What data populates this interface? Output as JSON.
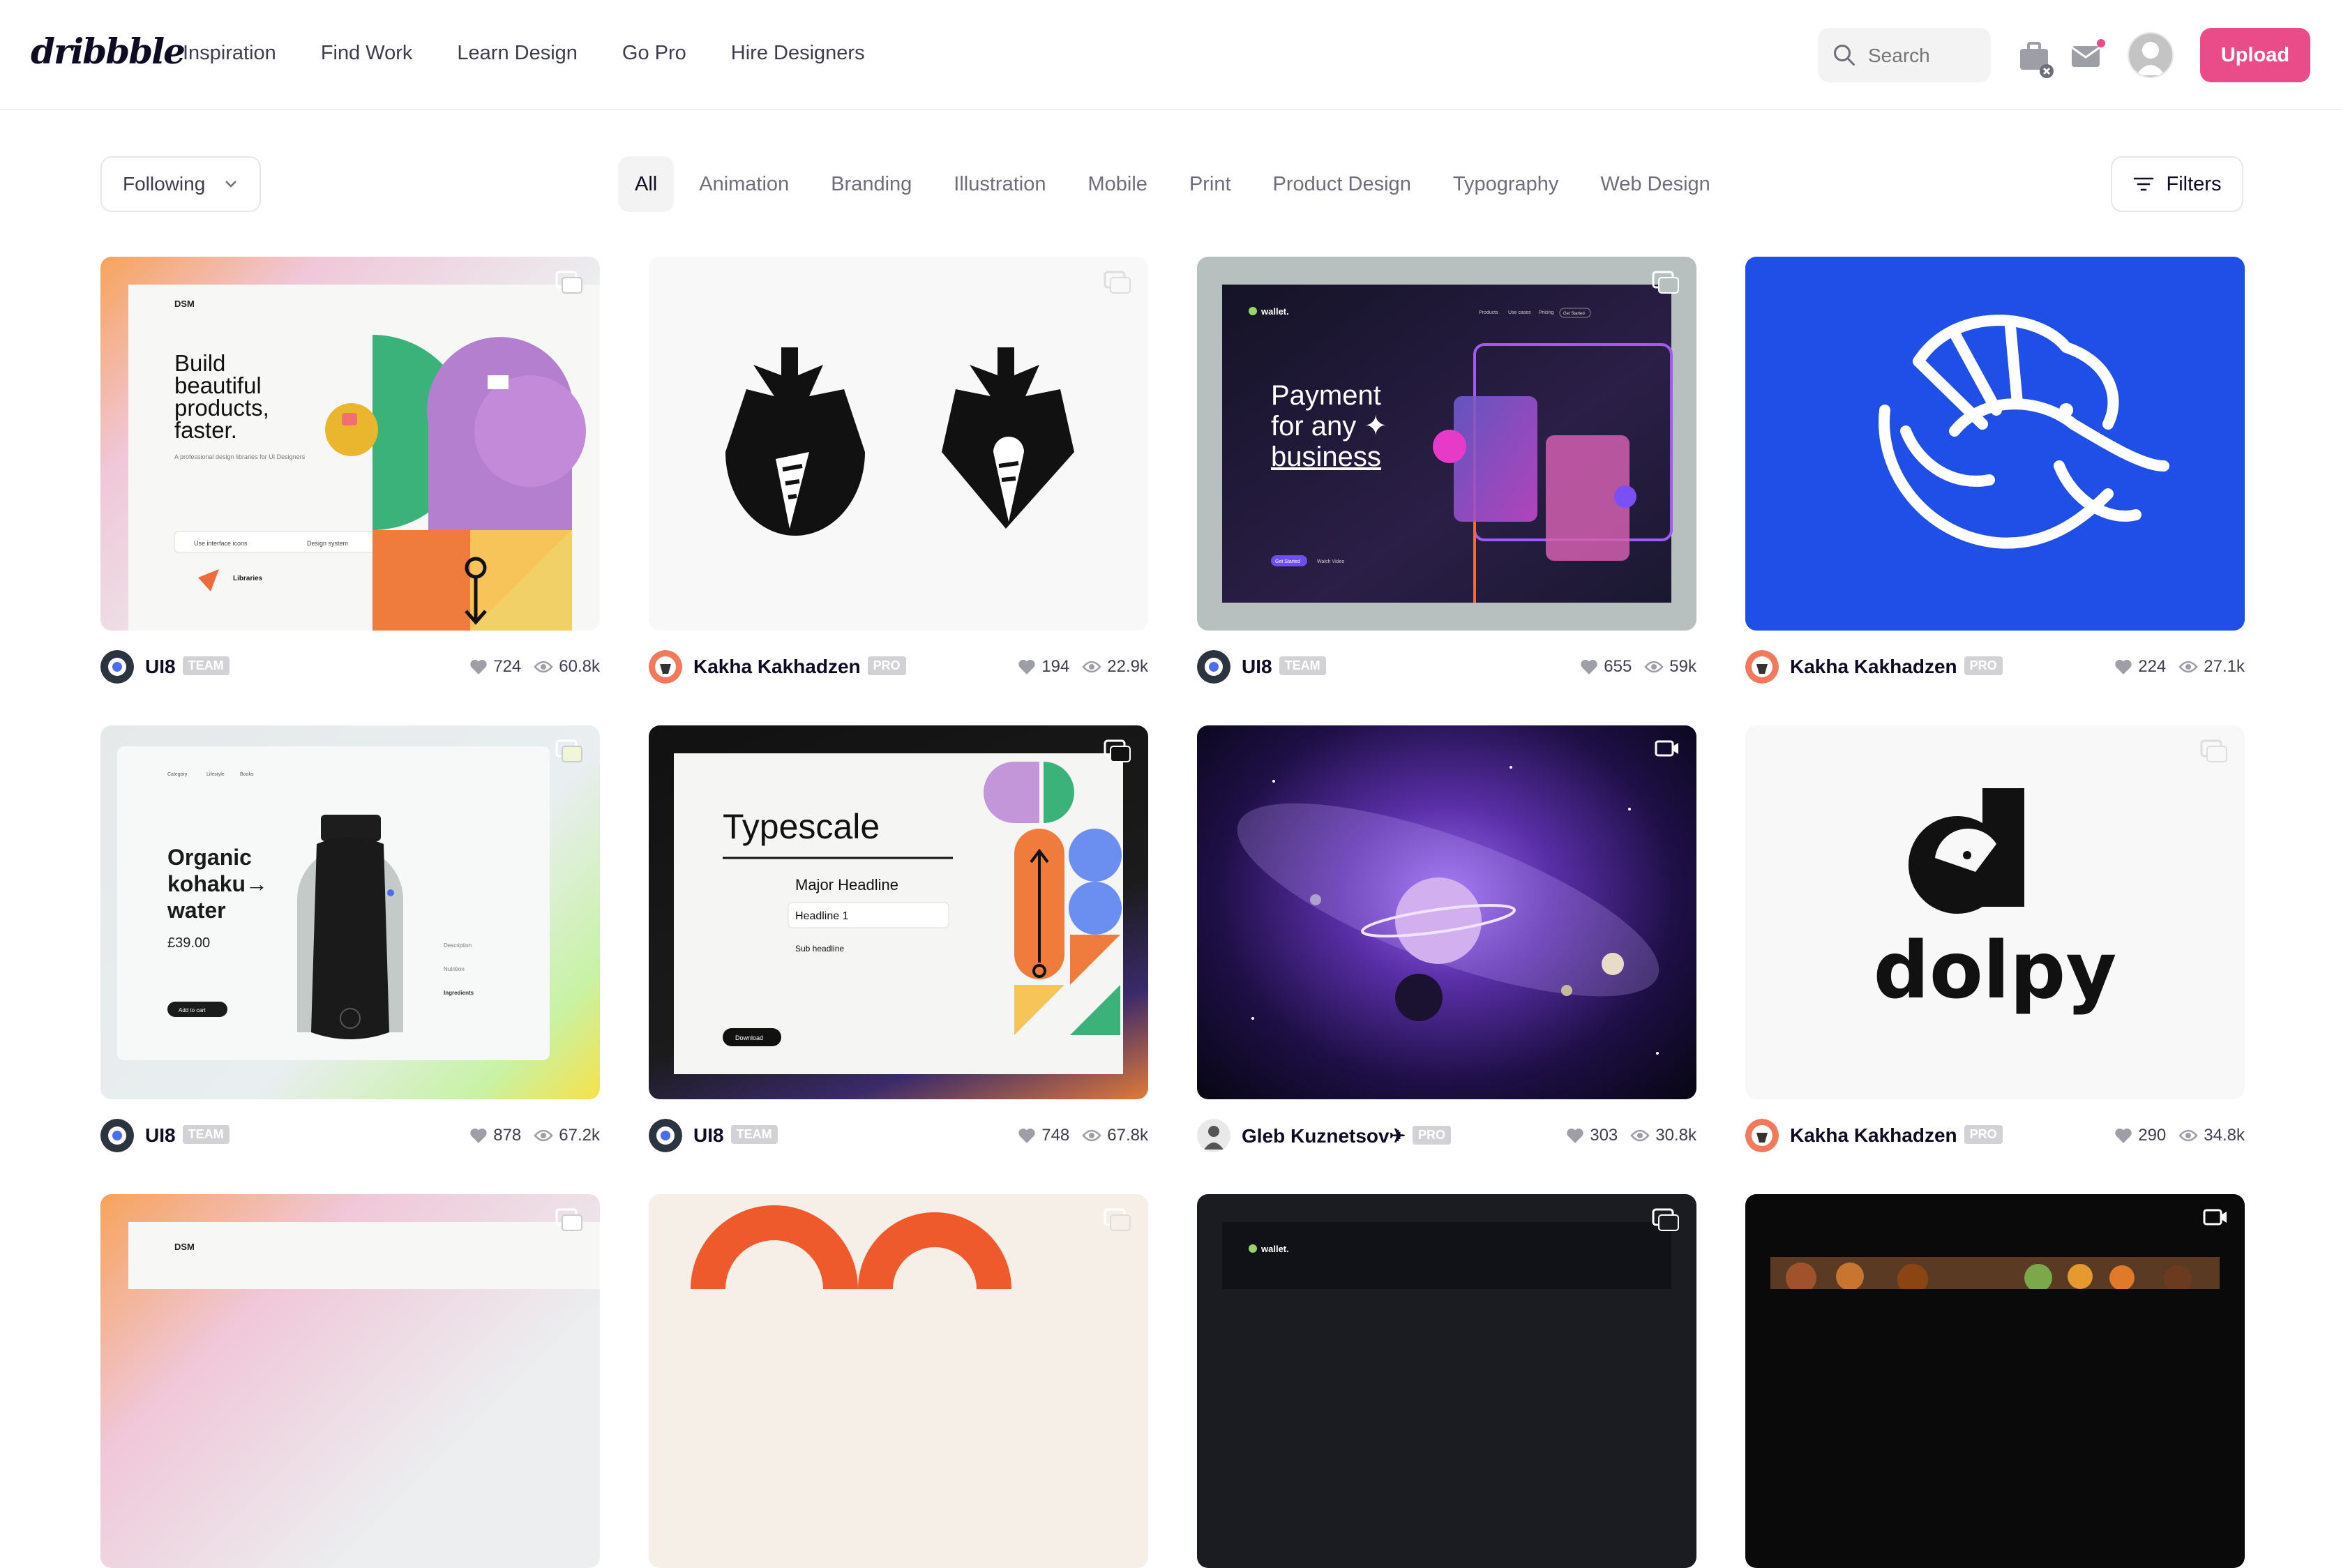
{
  "header": {
    "logo": "dribbble",
    "nav": [
      "Inspiration",
      "Find Work",
      "Learn Design",
      "Go Pro",
      "Hire Designers"
    ],
    "search_placeholder": "Search",
    "upload_label": "Upload",
    "icons": [
      "briefcase-icon",
      "mail-icon",
      "avatar"
    ]
  },
  "filter_bar": {
    "following_label": "Following",
    "categories": [
      "All",
      "Animation",
      "Branding",
      "Illustration",
      "Mobile",
      "Print",
      "Product Design",
      "Typography",
      "Web Design"
    ],
    "active_category": "All",
    "filters_label": "Filters"
  },
  "colors": {
    "brand_pink": "#ea4c89",
    "text_dark": "#0d0c22",
    "badge_gray": "#d2d2d6"
  },
  "shots": [
    {
      "author": "UI8",
      "tag": "TEAM",
      "likes": "724",
      "views": "60.8k",
      "art": {
        "brand": "DSM",
        "headline": [
          "Build",
          "beautiful",
          "products,",
          "faster."
        ],
        "sub": "A professional design libraries for UI Designers",
        "search_a": "Use interface icons",
        "search_b": "Design system",
        "list_title": "Libraries"
      }
    },
    {
      "author": "Kakha Kakhadzen",
      "tag": "PRO",
      "likes": "194",
      "views": "22.9k"
    },
    {
      "author": "UI8",
      "tag": "TEAM",
      "likes": "655",
      "views": "59k",
      "art": {
        "brand": "wallet.",
        "headline": [
          "Payment",
          "for any ✦",
          "business"
        ],
        "btn_a": "Get Started",
        "btn_b": "Watch Video",
        "nav": [
          "Products",
          "Use cases",
          "Pricing",
          "Get Started"
        ]
      }
    },
    {
      "author": "Kakha Kakhadzen",
      "tag": "PRO",
      "likes": "224",
      "views": "27.1k"
    },
    {
      "author": "UI8",
      "tag": "TEAM",
      "likes": "878",
      "views": "67.2k",
      "art": {
        "headline": [
          "Organic",
          "kohaku→",
          "water"
        ],
        "price": "£39.00",
        "cart": "Add to cart",
        "menu": [
          "Category",
          "Lifestyle",
          "Books"
        ],
        "details": [
          "Description",
          "Nutrition",
          "Ingredients"
        ]
      }
    },
    {
      "author": "UI8",
      "tag": "TEAM",
      "likes": "748",
      "views": "67.8k",
      "art": {
        "title": "Typescale",
        "rows": [
          "Major Headline",
          "Headline 1",
          "Sub headline"
        ],
        "download": "Download"
      }
    },
    {
      "author": "Gleb Kuznetsov✈",
      "tag": "PRO",
      "likes": "303",
      "views": "30.8k"
    },
    {
      "author": "Kakha Kakhadzen",
      "tag": "PRO",
      "likes": "290",
      "views": "34.8k",
      "art": {
        "word": "dolpy"
      }
    },
    {
      "author": "",
      "tag": "",
      "likes": "",
      "views": "",
      "art": {
        "brand": "DSM"
      }
    },
    {
      "author": "",
      "tag": "",
      "likes": "",
      "views": ""
    },
    {
      "author": "",
      "tag": "",
      "likes": "",
      "views": "",
      "art": {
        "brand": "wallet."
      }
    },
    {
      "author": "",
      "tag": "",
      "likes": "",
      "views": ""
    }
  ]
}
